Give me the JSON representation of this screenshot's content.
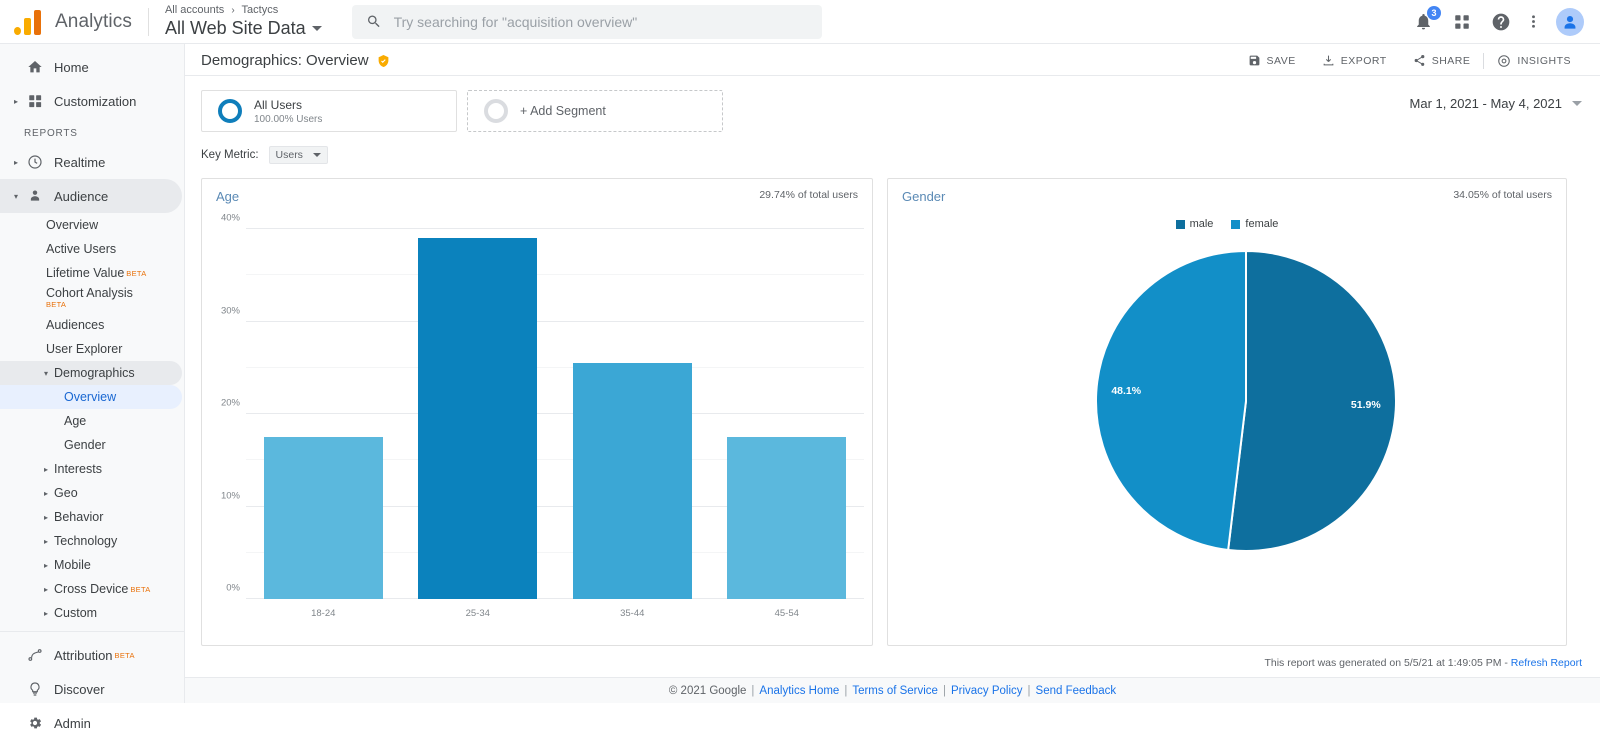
{
  "topbar": {
    "brand": "Analytics",
    "account_breadcrumb_root": "All accounts",
    "account_breadcrumb_sep": "›",
    "account_name": "Tactycs",
    "property_name": "All Web Site Data",
    "search_placeholder": "Try searching for \"acquisition overview\"",
    "search_value": "",
    "notification_count": "3"
  },
  "sidebar": {
    "section_label": "REPORTS",
    "home": "Home",
    "customization": "Customization",
    "realtime": "Realtime",
    "audience": "Audience",
    "audience_children": [
      {
        "label": "Overview",
        "beta": ""
      },
      {
        "label": "Active Users",
        "beta": ""
      },
      {
        "label": "Lifetime Value",
        "beta": "BETA"
      },
      {
        "label": "Cohort Analysis",
        "beta": "BETA"
      },
      {
        "label": "Audiences",
        "beta": ""
      },
      {
        "label": "User Explorer",
        "beta": ""
      }
    ],
    "demographics": "Demographics",
    "demographics_children": [
      {
        "label": "Overview"
      },
      {
        "label": "Age"
      },
      {
        "label": "Gender"
      }
    ],
    "audience_groups": [
      {
        "label": "Interests",
        "beta": ""
      },
      {
        "label": "Geo",
        "beta": ""
      },
      {
        "label": "Behavior",
        "beta": ""
      },
      {
        "label": "Technology",
        "beta": ""
      },
      {
        "label": "Mobile",
        "beta": ""
      },
      {
        "label": "Cross Device",
        "beta": "BETA"
      },
      {
        "label": "Custom",
        "beta": ""
      }
    ],
    "attribution": "Attribution",
    "attribution_beta": "BETA",
    "discover": "Discover",
    "admin": "Admin"
  },
  "page": {
    "title": "Demographics: Overview",
    "actions": [
      {
        "label": "SAVE",
        "icon": "save-icon"
      },
      {
        "label": "EXPORT",
        "icon": "export-icon"
      },
      {
        "label": "SHARE",
        "icon": "share-icon"
      },
      {
        "label": "INSIGHTS",
        "icon": "insights-icon"
      }
    ],
    "date_range": "Mar 1, 2021 - May 4, 2021",
    "segment": {
      "name": "All Users",
      "sub": "100.00% Users",
      "add_label": "+ Add Segment"
    },
    "key_metric_label": "Key Metric:",
    "key_metric_value": "Users",
    "generated_text": "This report was generated on 5/5/21 at 1:49:05 PM -",
    "refresh_link": "Refresh Report"
  },
  "footer": {
    "copyright": "© 2021 Google",
    "links": [
      "Analytics Home",
      "Terms of Service",
      "Privacy Policy",
      "Send Feedback"
    ]
  },
  "colors": {
    "accent_blue": "#1a73e8",
    "dark_blue": "#0b6fa4",
    "mid_blue": "#1e8bc3",
    "light_blue": "#56b4de",
    "pie_dark": "#0e6f9e",
    "pie_light": "#128fc8"
  },
  "chart_data": [
    {
      "type": "bar",
      "title": "Age",
      "subtitle": "29.74% of total users",
      "categories": [
        "18-24",
        "25-34",
        "35-44",
        "45-54"
      ],
      "values": [
        17.5,
        39.0,
        25.5,
        17.5
      ],
      "bar_colors": [
        "#5bb8dd",
        "#0b82bd",
        "#3ba7d5",
        "#5bb8dd"
      ],
      "xlabel": "",
      "ylabel": "",
      "ylim": [
        0,
        40
      ],
      "yticks": [
        "0%",
        "10%",
        "20%",
        "30%",
        "40%"
      ],
      "ytick_values": [
        0,
        10,
        20,
        30,
        40
      ],
      "grid": true,
      "legend": "none"
    },
    {
      "type": "pie",
      "title": "Gender",
      "subtitle": "34.05% of total users",
      "labels": [
        "male",
        "female"
      ],
      "values": [
        51.9,
        48.1
      ],
      "value_labels": [
        "51.9%",
        "48.1%"
      ],
      "slice_colors": [
        "#0e6f9e",
        "#128fc8"
      ],
      "legend": "top",
      "legend_entries": [
        {
          "label": "male",
          "color": "#0e6f9e"
        },
        {
          "label": "female",
          "color": "#128fc8"
        }
      ]
    }
  ]
}
